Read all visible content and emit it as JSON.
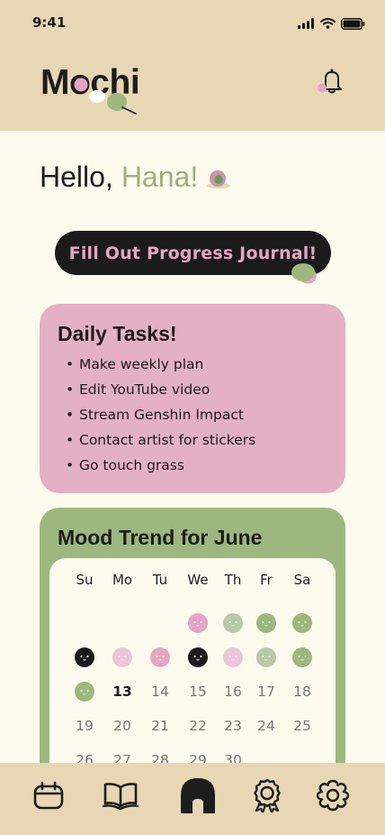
{
  "status": {
    "time": "9:41"
  },
  "header": {
    "logo": "Mochi"
  },
  "greeting": {
    "hello": "Hello,",
    "name": "Hana!"
  },
  "journal_button": {
    "label": "Fill Out Progress Journal!"
  },
  "tasks": {
    "title": "Daily Tasks!",
    "items": [
      "Make weekly plan",
      "Edit YouTube video",
      "Stream Genshin Impact",
      "Contact artist for stickers",
      "Go touch grass"
    ]
  },
  "mood": {
    "title": "Mood Trend for June",
    "weekdays": [
      "Su",
      "Mo",
      "Tu",
      "We",
      "Th",
      "Fr",
      "Sa"
    ],
    "today": 13,
    "colors": {
      "pink": "#e4a6c4",
      "lightpink": "#ebc6d7",
      "sage": "#b8c9a8",
      "green": "#9db87e",
      "black": "#1b1b1b"
    },
    "week1": [
      {
        "col": 3,
        "mood": "pink"
      },
      {
        "col": 4,
        "mood": "sage"
      },
      {
        "col": 5,
        "mood": "green"
      },
      {
        "col": 6,
        "mood": "green"
      }
    ],
    "week2": [
      {
        "col": 0,
        "mood": "black"
      },
      {
        "col": 1,
        "mood": "lightpink"
      },
      {
        "col": 2,
        "mood": "pink"
      },
      {
        "col": 3,
        "mood": "black"
      },
      {
        "col": 4,
        "mood": "lightpink"
      },
      {
        "col": 5,
        "mood": "sage"
      },
      {
        "col": 6,
        "mood": "green"
      }
    ],
    "week3": [
      {
        "col": 0,
        "mood": "green"
      },
      {
        "col": 1,
        "day": "13"
      },
      {
        "col": 2,
        "day": "14"
      },
      {
        "col": 3,
        "day": "15"
      },
      {
        "col": 4,
        "day": "16"
      },
      {
        "col": 5,
        "day": "17"
      },
      {
        "col": 6,
        "day": "18"
      }
    ],
    "week4": [
      "19",
      "20",
      "21",
      "22",
      "23",
      "24",
      "25"
    ],
    "week5": [
      "26",
      "27",
      "28",
      "29",
      "30"
    ]
  },
  "nav": {
    "icons": [
      "calendar-icon",
      "book-icon",
      "home-icon",
      "award-icon",
      "settings-flower-icon"
    ],
    "active": "home-icon"
  }
}
